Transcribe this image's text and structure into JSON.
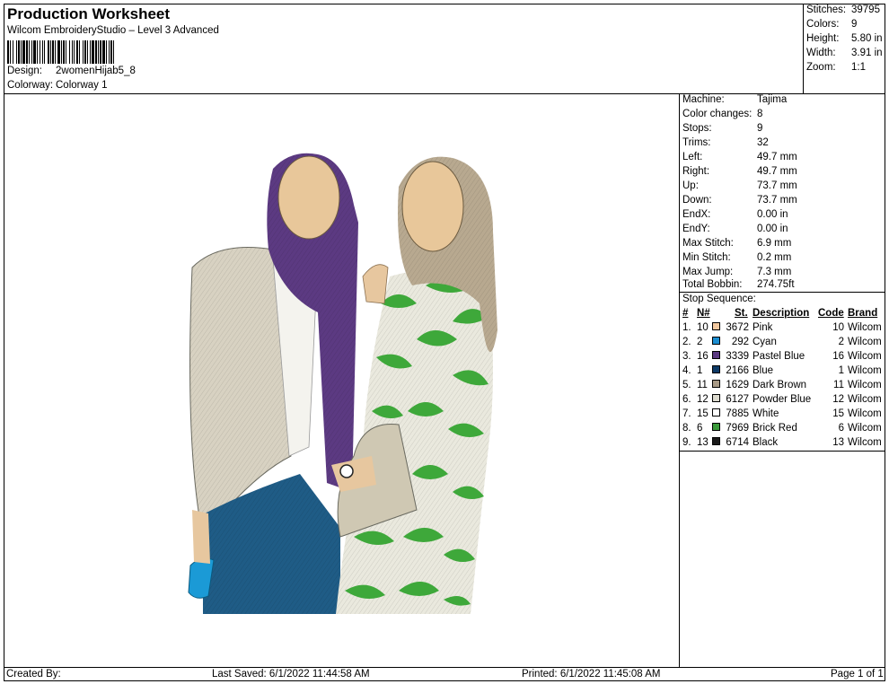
{
  "header": {
    "title": "Production Worksheet",
    "subtitle": "Wilcom EmbroideryStudio – Level 3 Advanced",
    "design_label": "Design:",
    "design_value": "2womenHijab5_8",
    "colorway_label": "Colorway:",
    "colorway_value": "Colorway 1"
  },
  "summary": [
    {
      "label": "Stitches:",
      "value": "39795"
    },
    {
      "label": "Colors:",
      "value": "9"
    },
    {
      "label": "Height:",
      "value": "5.80 in"
    },
    {
      "label": "Width:",
      "value": "3.91 in"
    },
    {
      "label": "Zoom:",
      "value": "1:1"
    }
  ],
  "properties": [
    {
      "label": "Machine:",
      "value": "Tajima"
    },
    {
      "label": "Color changes:",
      "value": "8"
    },
    {
      "label": "Stops:",
      "value": "9"
    },
    {
      "label": "Trims:",
      "value": "32"
    },
    {
      "label": "Left:",
      "value": "49.7 mm"
    },
    {
      "label": "Right:",
      "value": "49.7 mm"
    },
    {
      "label": "Up:",
      "value": "73.7 mm"
    },
    {
      "label": "Down:",
      "value": "73.7 mm"
    },
    {
      "label": "EndX:",
      "value": "0.00 in"
    },
    {
      "label": "EndY:",
      "value": "0.00 in"
    },
    {
      "label": "Max Stitch:",
      "value": "6.9 mm"
    },
    {
      "label": "Min Stitch:",
      "value": "0.2 mm"
    },
    {
      "label": "Max Jump:",
      "value": "7.3 mm"
    },
    {
      "label": "Total Bobbin:",
      "value": "274.75ft"
    }
  ],
  "stop_sequence": {
    "title": "Stop Sequence:",
    "headers": {
      "idx": "#",
      "n": "N#",
      "st": "St.",
      "description": "Description",
      "code": "Code",
      "brand": "Brand"
    },
    "rows": [
      {
        "idx": "1.",
        "n": "10",
        "color": "#F3C9A0",
        "st": "3672",
        "description": "Pink",
        "code": "10",
        "brand": "Wilcom"
      },
      {
        "idx": "2.",
        "n": "2",
        "color": "#1B8DD0",
        "st": "292",
        "description": "Cyan",
        "code": "2",
        "brand": "Wilcom"
      },
      {
        "idx": "3.",
        "n": "16",
        "color": "#5C3A82",
        "st": "3339",
        "description": "Pastel Blue",
        "code": "16",
        "brand": "Wilcom"
      },
      {
        "idx": "4.",
        "n": "1",
        "color": "#0E3A66",
        "st": "2166",
        "description": "Blue",
        "code": "1",
        "brand": "Wilcom"
      },
      {
        "idx": "5.",
        "n": "11",
        "color": "#A89A86",
        "st": "1629",
        "description": "Dark Brown",
        "code": "11",
        "brand": "Wilcom"
      },
      {
        "idx": "6.",
        "n": "12",
        "color": "#DDDBCF",
        "st": "6127",
        "description": "Powder Blue",
        "code": "12",
        "brand": "Wilcom"
      },
      {
        "idx": "7.",
        "n": "15",
        "color": "#FFFFFF",
        "st": "7885",
        "description": "White",
        "code": "15",
        "brand": "Wilcom"
      },
      {
        "idx": "8.",
        "n": "6",
        "color": "#3A9A3A",
        "st": "7969",
        "description": "Brick Red",
        "code": "6",
        "brand": "Wilcom"
      },
      {
        "idx": "9.",
        "n": "13",
        "color": "#1A1A1A",
        "st": "6714",
        "description": "Black",
        "code": "13",
        "brand": "Wilcom"
      }
    ]
  },
  "footer": {
    "created": "Created By:",
    "last_saved": "Last Saved: 6/1/2022 11:44:58 AM",
    "printed": "Printed: 6/1/2022 11:45:08 AM",
    "page": "Page 1 of 1"
  }
}
